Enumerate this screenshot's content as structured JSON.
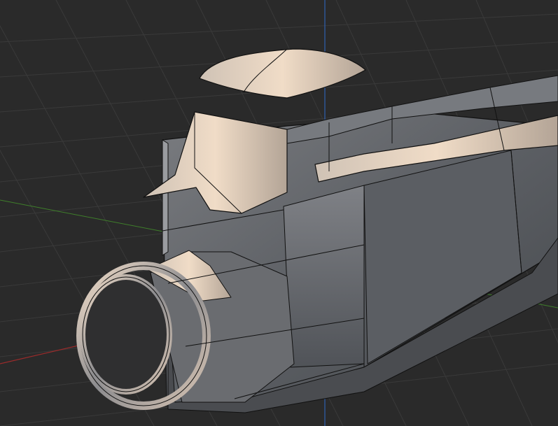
{
  "app": {
    "panel": "3D Viewport",
    "background_color": "#2a2a2a"
  },
  "viewport": {
    "grid": true,
    "grid_color": "#3a3a3a",
    "axes": {
      "x_axis_color": "#9b2b2b",
      "y_axis_color": "#3f7f2a",
      "z_axis_color": "#2f5fb0"
    },
    "object": {
      "shading": "solid",
      "wireframe_overlay": true,
      "base_color": "#6b6e73",
      "highlight_color": "#e6d2bf",
      "edge_color": "#111111"
    }
  }
}
